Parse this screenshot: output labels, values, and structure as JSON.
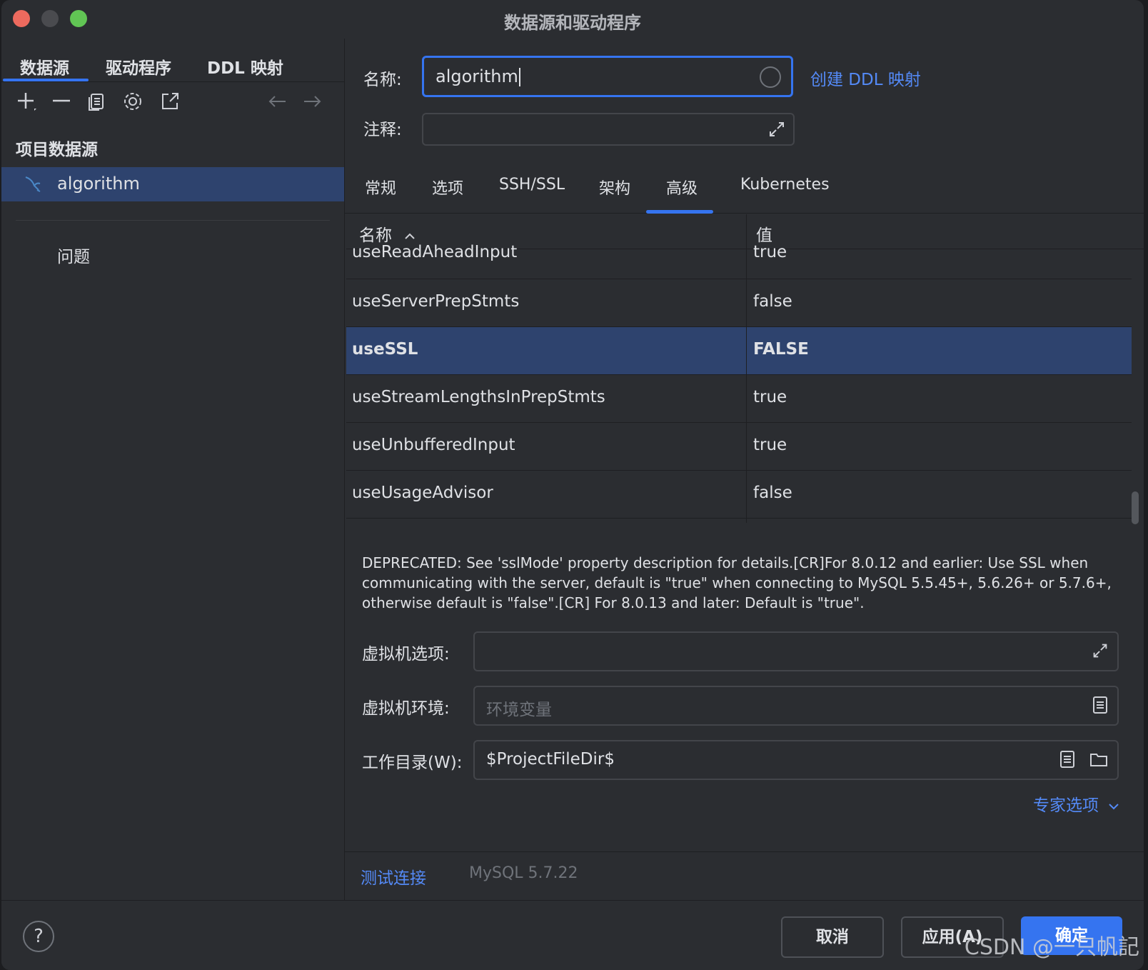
{
  "window": {
    "title": "数据源和驱动程序"
  },
  "left": {
    "tabs": [
      "数据源",
      "驱动程序",
      "DDL 映射"
    ],
    "section_title": "项目数据源",
    "datasource": "algorithm",
    "problems": "问题"
  },
  "form": {
    "name_label": "名称:",
    "name_value": "algorithm",
    "create_ddl_link": "创建 DDL 映射",
    "comment_label": "注释:"
  },
  "tabs": [
    "常规",
    "选项",
    "SSH/SSL",
    "架构",
    "高级",
    "Kubernetes"
  ],
  "active_tab": "高级",
  "table": {
    "col_name": "名称",
    "col_value": "值",
    "rows": [
      {
        "name": "useReadAheadInput",
        "value": "true"
      },
      {
        "name": "useServerPrepStmts",
        "value": "false"
      },
      {
        "name": "useSSL",
        "value": "FALSE"
      },
      {
        "name": "useStreamLengthsInPrepStmts",
        "value": "true"
      },
      {
        "name": "useUnbufferedInput",
        "value": "true"
      },
      {
        "name": "useUsageAdvisor",
        "value": "false"
      }
    ]
  },
  "description": "DEPRECATED: See 'sslMode' property description for details.[CR]For 8.0.12 and earlier: Use SSL when communicating with the server, default is \"true\" when connecting to MySQL 5.5.45+, 5.6.26+ or 5.7.6+, otherwise default is \"false\".[CR] For 8.0.13 and later: Default is \"true\".",
  "vm": {
    "options_label": "虚拟机选项:",
    "env_label": "虚拟机环境:",
    "env_placeholder": "环境变量",
    "workdir_label": "工作目录(W):",
    "workdir_value": "$ProjectFileDir$",
    "expert_options": "专家选项"
  },
  "status": {
    "test_connection": "测试连接",
    "version": "MySQL 5.7.22"
  },
  "footer": {
    "cancel": "取消",
    "apply": "应用(A)",
    "ok": "确定",
    "watermark": "CSDN @一只帆記"
  },
  "colors": {
    "accent": "#3574f0",
    "selection": "#2e436e",
    "link": "#548af7"
  }
}
